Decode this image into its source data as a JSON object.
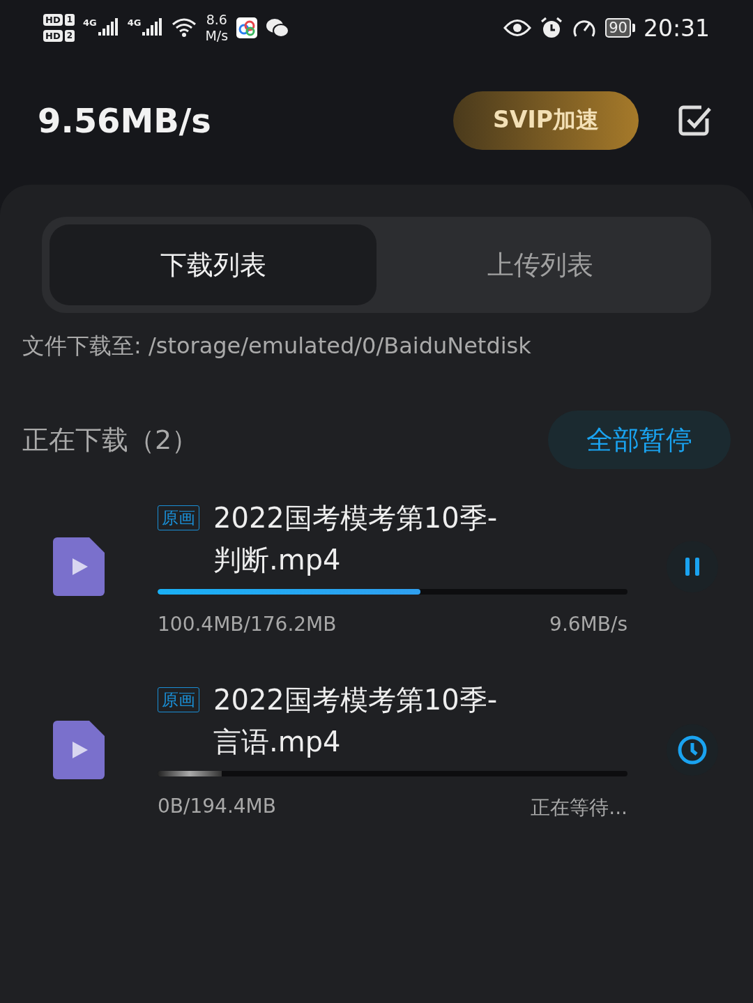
{
  "status_bar": {
    "sim_badges": [
      {
        "label": "HD",
        "slot": "1"
      },
      {
        "label": "HD",
        "slot": "2"
      }
    ],
    "network_labels": [
      "4G",
      "4G"
    ],
    "speed_value": "8.6",
    "speed_unit": "M/s",
    "battery": "90",
    "time": "20:31"
  },
  "header": {
    "speed": "9.56MB/s",
    "svip_button": "SVIP加速"
  },
  "tabs": [
    {
      "label": "下载列表",
      "selected": true
    },
    {
      "label": "上传列表",
      "selected": false
    }
  ],
  "path_label": "文件下载至: /storage/emulated/0/BaiduNetdisk",
  "section": {
    "title": "正在下载（2）",
    "action": "全部暂停"
  },
  "downloads": [
    {
      "kind": "downloading",
      "badge": "原画",
      "title": "2022国考模考第10季-判断.mp4",
      "level": 0.56,
      "size": "100.4MB/176.2MB",
      "status": "9.6MB/s"
    },
    {
      "kind": "waiting",
      "badge": "原画",
      "title": "2022国考模考第10季-言语.mp4",
      "level": 0,
      "size": "0B/194.4MB",
      "status": "正在等待..."
    }
  ]
}
